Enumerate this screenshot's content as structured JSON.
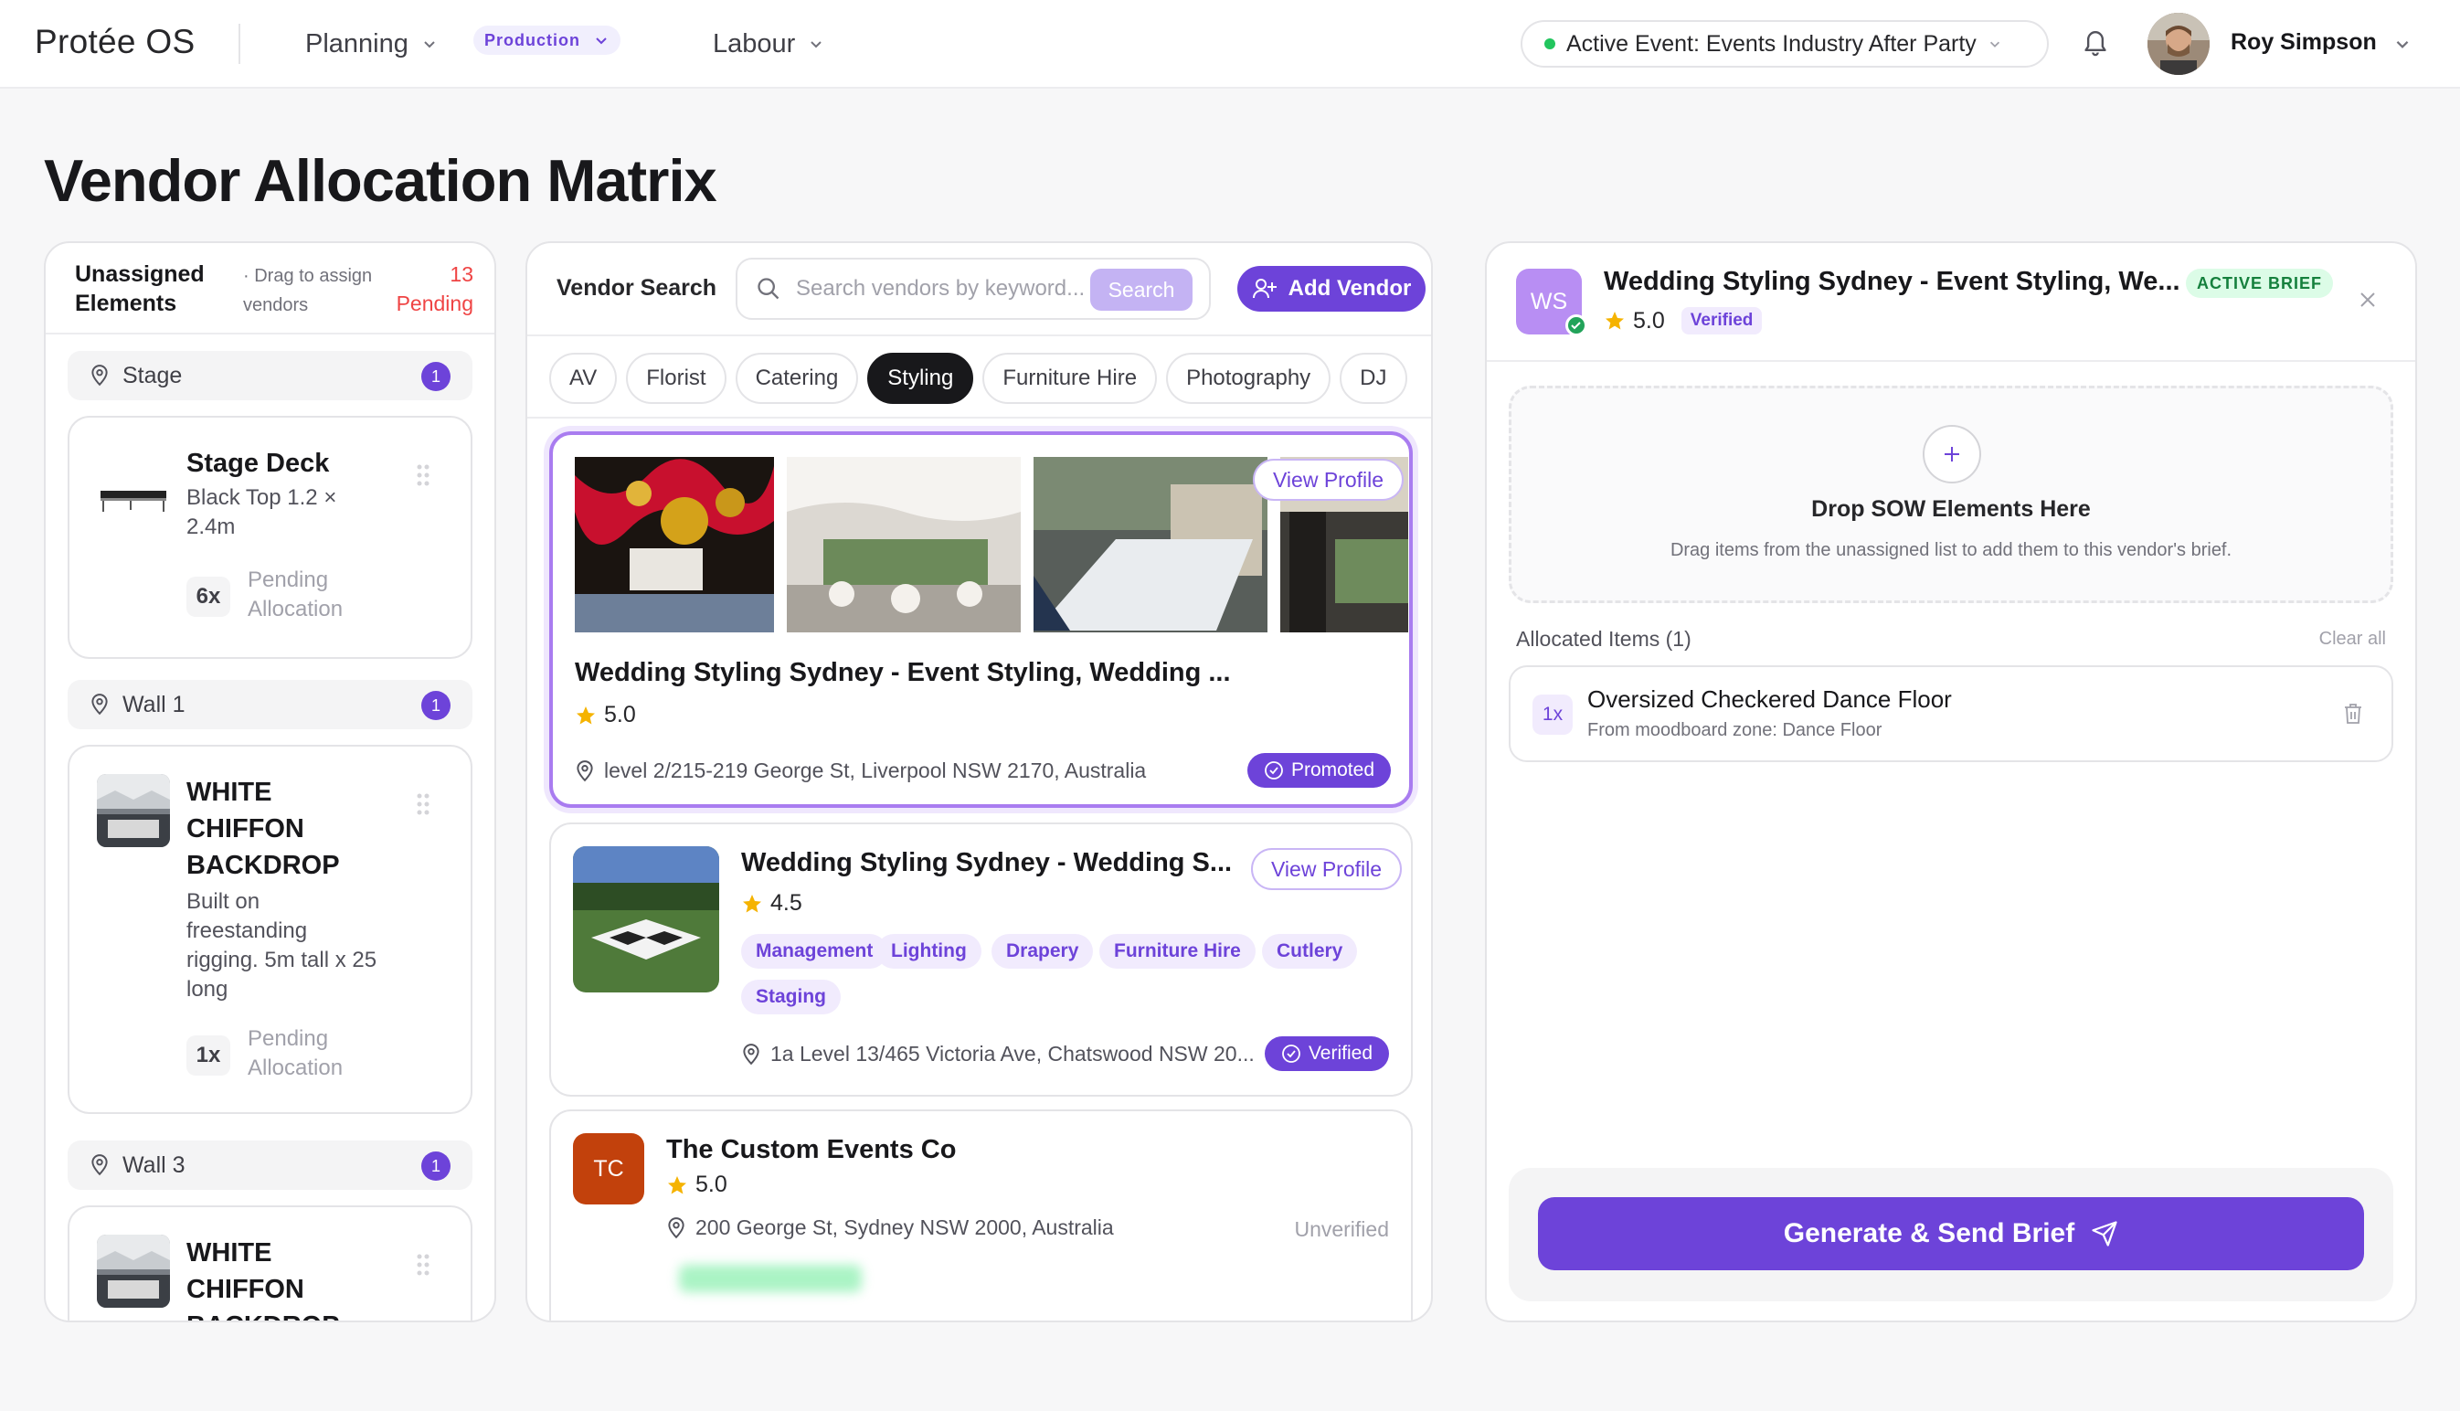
{
  "app": {
    "title": "Protée OS"
  },
  "nav": {
    "items": [
      {
        "label": "Planning"
      },
      {
        "label": "Production"
      },
      {
        "label": "Labour"
      }
    ]
  },
  "event": {
    "label": "Active Event: Events Industry After Party"
  },
  "user": {
    "name": "Roy Simpson"
  },
  "page": {
    "title": "Vendor Allocation Matrix"
  },
  "unassigned": {
    "title": "Unassigned Elements",
    "hint": "· Drag to assign vendors",
    "pending": "13 Pending",
    "zones": [
      {
        "name": "Stage",
        "count": "1"
      },
      {
        "name": "Wall 1",
        "count": "1"
      },
      {
        "name": "Wall 3",
        "count": "1"
      }
    ],
    "items": [
      {
        "title": "Stage Deck",
        "desc": "Black Top 1.2 × 2.4m",
        "qty": "6x",
        "status": "Pending Allocation"
      },
      {
        "title": "WHITE CHIFFON BACKDROP",
        "desc": "Built on freestanding rigging. 5m tall x 25 long",
        "qty": "1x",
        "status": "Pending Allocation"
      },
      {
        "title": "WHITE CHIFFON BACKDROP"
      }
    ]
  },
  "vendor_search": {
    "label": "Vendor Search",
    "placeholder": "Search vendors by keyword...",
    "search_button": "Search",
    "add_button": "Add Vendor",
    "categories": [
      "AV",
      "Florist",
      "Catering",
      "Styling",
      "Furniture Hire",
      "Photography",
      "DJ"
    ],
    "selected_category": "Styling"
  },
  "vendors": [
    {
      "name": "Wedding Styling Sydney - Event Styling, Wedding ...",
      "rating": "5.0",
      "address": "level 2/215-219 George St, Liverpool NSW 2170, Australia",
      "badge": "Promoted",
      "action": "View Profile"
    },
    {
      "name": "Wedding Styling Sydney - Wedding S...",
      "rating": "4.5",
      "tags": [
        "Management",
        "Lighting",
        "Drapery",
        "Furniture Hire",
        "Cutlery",
        "Staging"
      ],
      "address": "1a Level 13/465 Victoria Ave, Chatswood NSW 20...",
      "badge": "Verified",
      "action": "View Profile"
    },
    {
      "initials": "TC",
      "name": "The Custom Events Co",
      "rating": "5.0",
      "address": "200 George St, Sydney NSW 2000, Australia",
      "status": "Unverified"
    }
  ],
  "brief": {
    "initials": "WS",
    "vendor": "Wedding Styling Sydney - Event Styling, We...",
    "status": "ACTIVE BRIEF",
    "rating": "5.0",
    "verified": "Verified",
    "drop_title": "Drop SOW Elements Here",
    "drop_sub": "Drag items from the unassigned list to add them to this vendor's brief.",
    "allocated_label": "Allocated Items (1)",
    "clear_all": "Clear all",
    "items": [
      {
        "qty": "1x",
        "name": "Oversized Checkered Dance Floor",
        "source": "From moodboard zone: Dance Floor"
      }
    ],
    "generate": "Generate & Send Brief"
  },
  "colors": {
    "accent": "#6d43d9",
    "danger": "#ef4444",
    "success": "#22c55e",
    "star": "#f5b301"
  }
}
